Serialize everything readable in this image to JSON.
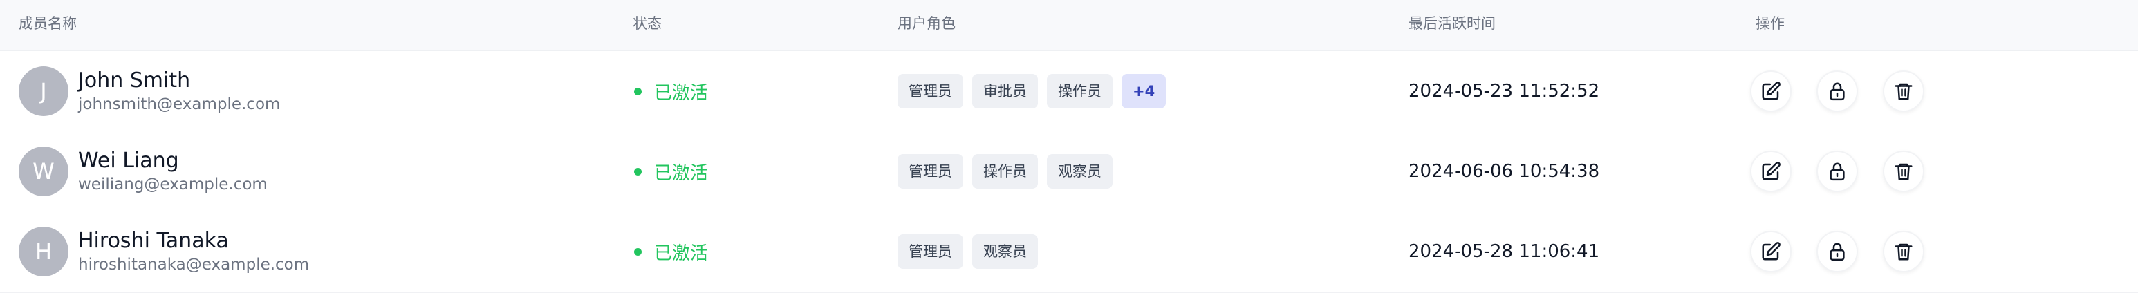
{
  "headers": {
    "member": "成员名称",
    "status": "状态",
    "roles": "用户角色",
    "last_active": "最后活跃时间",
    "actions": "操作"
  },
  "rows": [
    {
      "avatar": "J",
      "name": "John Smith",
      "email": "johnsmith@example.com",
      "status": "已激活",
      "roles": [
        "管理员",
        "审批员",
        "操作员"
      ],
      "more": "+4",
      "last_active": "2024-05-23 11:52:52"
    },
    {
      "avatar": "W",
      "name": "Wei Liang",
      "email": "weiliang@example.com",
      "status": "已激活",
      "roles": [
        "管理员",
        "操作员",
        "观察员"
      ],
      "more": null,
      "last_active": "2024-06-06 10:54:38"
    },
    {
      "avatar": "H",
      "name": "Hiroshi Tanaka",
      "email": "hiroshitanaka@example.com",
      "status": "已激活",
      "roles": [
        "管理员",
        "观察员"
      ],
      "more": null,
      "last_active": "2024-05-28 11:06:41"
    }
  ],
  "icons": {
    "edit": "edit-icon",
    "lock": "lock-icon",
    "delete": "trash-icon"
  },
  "colors": {
    "status_active": "#22c55e",
    "more_badge_bg": "#dfe2fb",
    "more_badge_text": "#3341b8",
    "role_tag_bg": "#eef0f4",
    "avatar_bg": "#b5b8c2"
  }
}
